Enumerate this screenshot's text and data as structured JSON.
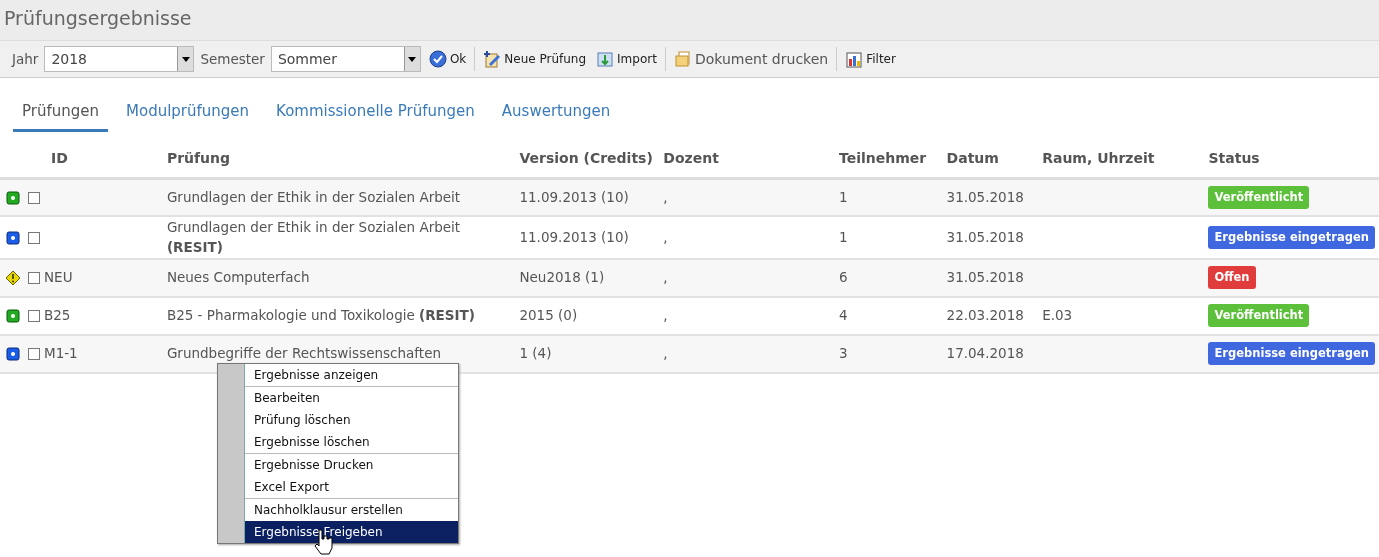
{
  "page_title": "Prüfungsergebnisse",
  "toolbar": {
    "year_label": "Jahr",
    "year_value": "2018",
    "semester_label": "Semester",
    "semester_value": "Sommer",
    "buttons": [
      {
        "kind": "ok",
        "label": "Ok"
      },
      {
        "kind": "new",
        "label": "Neue Prüfung"
      },
      {
        "kind": "import",
        "label": "Import"
      },
      {
        "kind": "print",
        "label": "Dokument drucken"
      },
      {
        "kind": "filter",
        "label": "Filter"
      }
    ]
  },
  "tabs": [
    {
      "label": "Prüfungen",
      "selected": true
    },
    {
      "label": "Modulprüfungen",
      "selected": false
    },
    {
      "label": "Kommissionelle Prüfungen",
      "selected": false
    },
    {
      "label": "Auswertungen",
      "selected": false
    }
  ],
  "table": {
    "columns": [
      "ID",
      "Prüfung",
      "Version (Credits)",
      "Dozent",
      "Teilnehmer",
      "Datum",
      "Raum, Uhrzeit",
      "Status"
    ],
    "rows": [
      {
        "kind": "green",
        "checked": false,
        "id": "",
        "exam": "Grundlagen der Ethik in der Sozialen Arbeit",
        "version": "11.09.2013 (10)",
        "lecturer": ",",
        "participants": "1",
        "date": "31.05.2018",
        "room": "",
        "status": "Veröffentlicht",
        "color": "#5cc03a"
      },
      {
        "kind": "blue",
        "checked": false,
        "id": "",
        "exam": "Grundlagen der Ethik in der Sozialen Arbeit **(RESIT)**",
        "version": "11.09.2013 (10)",
        "lecturer": ",",
        "participants": "1",
        "date": "31.05.2018",
        "room": "",
        "status": "Ergebnisse eingetragen",
        "color": "#3f67e0"
      },
      {
        "kind": "warning",
        "checked": false,
        "id": "NEU",
        "exam": "Neues Computerfach",
        "version": "Neu2018 (1)",
        "lecturer": ",",
        "participants": "6",
        "date": "31.05.2018",
        "room": "",
        "status": "Offen",
        "color": "#e03c3c"
      },
      {
        "kind": "green",
        "checked": false,
        "id": "B25",
        "exam": "B25 - Pharmakologie und Toxikologie **(RESIT)**",
        "version": "2015 (0)",
        "lecturer": ",",
        "participants": "4",
        "date": "22.03.2018",
        "room": "E.03",
        "status": "Veröffentlicht",
        "color": "#5cc03a"
      },
      {
        "kind": "blue",
        "checked": false,
        "id": "M1-1",
        "exam": "Grundbegriffe der Rechtswissenschaften",
        "version": "1 (4)",
        "lecturer": ",",
        "participants": "3",
        "date": "17.04.2018",
        "room": "",
        "status": "Ergebnisse eingetragen",
        "color": "#3f67e0"
      }
    ]
  },
  "context_menu": {
    "groups": [
      [
        {
          "label": "Ergebnisse anzeigen",
          "selected": false
        }
      ],
      [
        {
          "label": "Bearbeiten",
          "selected": false
        },
        {
          "label": "Prüfung löschen",
          "selected": false
        },
        {
          "label": "Ergebnisse löschen",
          "selected": false
        }
      ],
      [
        {
          "label": "Ergebnisse Drucken",
          "selected": false
        },
        {
          "label": "Excel Export",
          "selected": false
        }
      ],
      [
        {
          "label": "Nachholklausur erstellen",
          "selected": false
        },
        {
          "label": "Ergebnisse Freigeben",
          "selected": true
        }
      ]
    ]
  }
}
